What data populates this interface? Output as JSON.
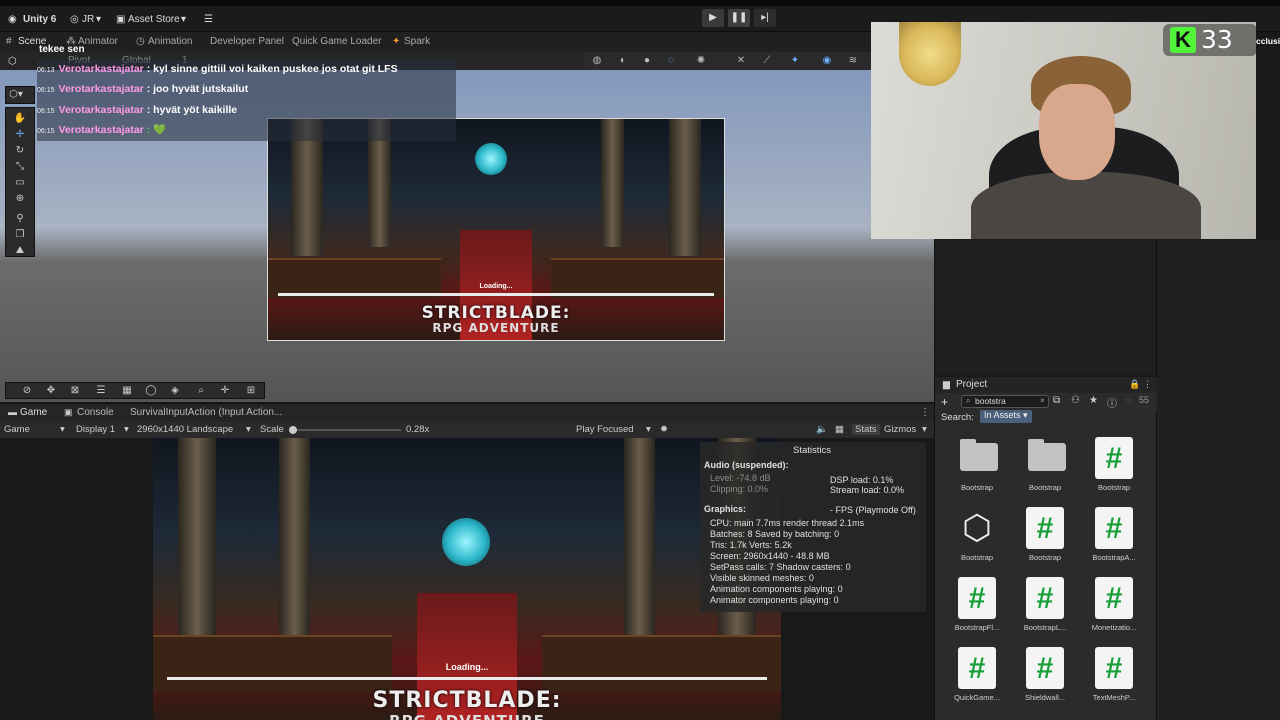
{
  "toolbar": {
    "app_title": "Unity 6",
    "account": "JR",
    "asset_store": "Asset Store"
  },
  "scene_tabs": [
    "Scene",
    "Animator",
    "Animation",
    "Developer Panel",
    "Quick Game Loader",
    "Spark"
  ],
  "scene_overlay": {
    "pivot": "Pivot",
    "global": "Global",
    "grid_num": "1"
  },
  "chat": {
    "header": "tekee sen",
    "messages": [
      {
        "time": "06:13",
        "user": "Verotarkastajatar",
        "text": ": kyl sinne gittiil voi kaiken puskee jos otat git LFS"
      },
      {
        "time": "06:15",
        "user": "Verotarkastajatar",
        "text": ": joo hyvät jutskailut"
      },
      {
        "time": "06:15",
        "user": "Verotarkastajatar",
        "text": ": hyvät yöt kaikille"
      },
      {
        "time": "06:15",
        "user": "Verotarkastajatar",
        "text": ": 💚"
      }
    ]
  },
  "game_art": {
    "title": "STRICTBLADE:",
    "subtitle": "RPG ADVENTURE",
    "loading": "Loading...",
    "progress": 0.0
  },
  "kick": {
    "count": "33"
  },
  "cut_text": "cclusi",
  "project": {
    "tab": "Project",
    "search_value": "bootstra",
    "search_label": "Search:",
    "scope": "In Assets",
    "hidden_count": "55",
    "assets": [
      {
        "label": "Bootstrap",
        "kind": "folder"
      },
      {
        "label": "Bootstrap",
        "kind": "folder"
      },
      {
        "label": "Bootstrap",
        "kind": "script"
      },
      {
        "label": "Bootstrap",
        "kind": "unity"
      },
      {
        "label": "Bootstrap",
        "kind": "script"
      },
      {
        "label": "BootstrapA...",
        "kind": "script"
      },
      {
        "label": "BootstrapFl...",
        "kind": "script"
      },
      {
        "label": "BootstrapL...",
        "kind": "script"
      },
      {
        "label": "Monetizatio...",
        "kind": "script"
      },
      {
        "label": "QuickGame...",
        "kind": "script"
      },
      {
        "label": "Shieldwall...",
        "kind": "script"
      },
      {
        "label": "TextMeshP...",
        "kind": "script"
      }
    ]
  },
  "game_tabs": {
    "game": "Game",
    "console": "Console",
    "input": "SurvivalInputAction (Input Action..."
  },
  "game_controls": {
    "game": "Game",
    "display": "Display 1",
    "resolution": "2960x1440 Landscape",
    "scale_label": "Scale",
    "scale_value": "0.28x",
    "play_focused": "Play Focused",
    "stats": "Stats",
    "gizmos": "Gizmos",
    "scale_level": 0.0
  },
  "stats": {
    "title": "Statistics",
    "audio_header": "Audio (suspended):",
    "level": "Level: -74.8 dB",
    "clipping": "Clipping: 0.0%",
    "dsp": "DSP load: 0.1%",
    "stream": "Stream load: 0.0%",
    "graphics_header": "Graphics:",
    "fps": "- FPS (Playmode Off)",
    "cpu": "CPU: main 7.7ms  render thread 2.1ms",
    "batches": "Batches: 8    Saved by batching: 0",
    "tris": "Tris: 1.7k   Verts: 5.2k",
    "screen": "Screen: 2960x1440 - 48.8 MB",
    "setpass": "SetPass calls: 7  Shadow casters: 0",
    "skinned": "Visible skinned meshes: 0",
    "anim_comp": "Animation components playing: 0",
    "animator_comp": "Animator components playing: 0"
  }
}
